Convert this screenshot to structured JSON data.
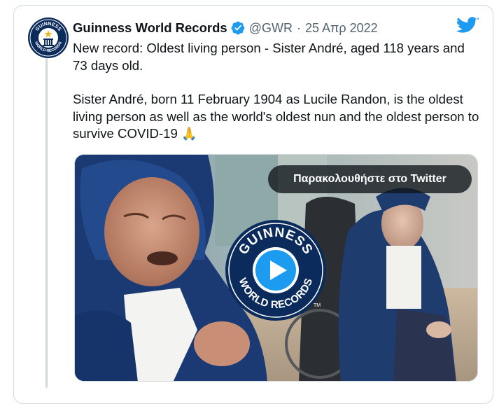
{
  "tweet": {
    "display_name": "Guinness World Records",
    "handle": "@GWR",
    "separator": "·",
    "date": "25 Απρ 2022",
    "text_line_1": "New record: Oldest living person - Sister André, aged 118 years and 73 days old.",
    "text_line_2": "Sister André, born 11 February 1904 as Lucile Randon, is the oldest living person as well as the world's oldest nun and the oldest person to survive COVID-19",
    "emoji": "🙏"
  },
  "media": {
    "watch_label": "Παρακολουθήστε στο Twitter",
    "badge_top": "GUINNESS",
    "badge_bottom": "WORLD RECORDS",
    "badge_tm": "TM",
    "avatar_text_top": "GUINNESS",
    "avatar_text_bottom": "WORLD RECORDS"
  },
  "colors": {
    "verified": "#1d9bf0",
    "twitter_blue": "#1d9bf0",
    "gwr_navy": "#0b2b5c",
    "text": "#0f1419",
    "muted": "#536471"
  },
  "icons": [
    "gwr-avatar-icon",
    "verified-badge-icon",
    "twitter-bird-icon",
    "play-icon"
  ]
}
